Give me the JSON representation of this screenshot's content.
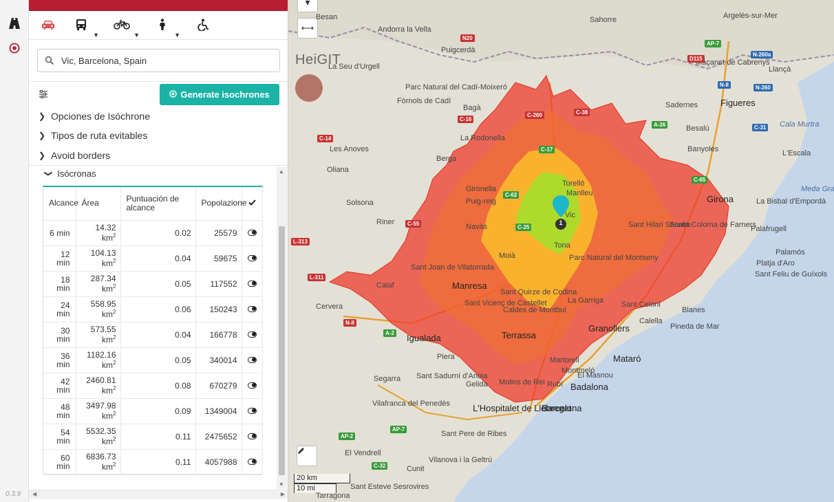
{
  "version": "0.3.9",
  "rail": {
    "items": [
      {
        "icon": "road-icon"
      },
      {
        "icon": "isochrone-target-icon"
      }
    ]
  },
  "profiles": [
    {
      "icon": "car-icon",
      "active": true
    },
    {
      "icon": "bus-icon",
      "dropdown": true
    },
    {
      "icon": "bicycle-icon",
      "dropdown": true
    },
    {
      "icon": "walking-icon",
      "dropdown": true
    },
    {
      "icon": "wheelchair-icon",
      "dropdown": false
    }
  ],
  "search": {
    "value": "Vic, Barcelona, Spain",
    "placeholder": ""
  },
  "generate_button": "Generate isochrones",
  "sections": {
    "options": "Opciones de Isóchrone",
    "avoidables": "Tipos de ruta evitables",
    "borders": "Avoid borders",
    "isochrones": "Isócronas"
  },
  "table": {
    "headers": {
      "range": "Alcance",
      "area": "Área",
      "score": "Puntuación de alcance",
      "population": "Popolazione"
    },
    "area_unit": "km",
    "rows": [
      {
        "range": "6 min",
        "area": "14.32",
        "score": "0.02",
        "population": "25579"
      },
      {
        "range": "12 min",
        "area": "104.13",
        "score": "0.04",
        "population": "59675"
      },
      {
        "range": "18 min",
        "area": "287.34",
        "score": "0.05",
        "population": "117552"
      },
      {
        "range": "24 min",
        "area": "558.95",
        "score": "0.06",
        "population": "150243"
      },
      {
        "range": "30 min",
        "area": "573.55",
        "score": "0.04",
        "population": "166778"
      },
      {
        "range": "36 min",
        "area": "1182.16",
        "score": "0.05",
        "population": "340014"
      },
      {
        "range": "42 min",
        "area": "2460.81",
        "score": "0.08",
        "population": "670279"
      },
      {
        "range": "48 min",
        "area": "3497.98",
        "score": "0.09",
        "population": "1349004"
      },
      {
        "range": "54 min",
        "area": "5532.35",
        "score": "0.11",
        "population": "2475652"
      },
      {
        "range": "60 min",
        "area": "6836.73",
        "score": "0.11",
        "population": "4057988"
      }
    ]
  },
  "map": {
    "brand": "HeiGIT",
    "pin_label": "1",
    "scale": {
      "km": "20 km",
      "mi": "10 mi"
    },
    "colors": {
      "inner": "#9be52a",
      "mid": "#ffd028",
      "outer": "#ef3c2d",
      "water": "#c5d6ea",
      "land": "#e3e1d6"
    },
    "places": [
      {
        "name": "Andorra la Vella"
      },
      {
        "name": "La Seu d'Urgell"
      },
      {
        "name": "Besan"
      },
      {
        "name": "Puigcerdà"
      },
      {
        "name": "Sahorre"
      },
      {
        "name": "Argelès-sur-Mer"
      },
      {
        "name": "Maçanet de Cabrenys"
      },
      {
        "name": "Llançà"
      },
      {
        "name": "Parc Natural del Cadí-Moixeró"
      },
      {
        "name": "Fòrnols de Cadí"
      },
      {
        "name": "Bagà"
      },
      {
        "name": "La Rodonella"
      },
      {
        "name": "Sadernes"
      },
      {
        "name": "Figueres"
      },
      {
        "name": "Besalú"
      },
      {
        "name": "Banyoles"
      },
      {
        "name": "Cala Murtra"
      },
      {
        "name": "L'Escala"
      },
      {
        "name": "Les Anoves"
      },
      {
        "name": "Oliana"
      },
      {
        "name": "Solsona"
      },
      {
        "name": "Riner"
      },
      {
        "name": "Berga"
      },
      {
        "name": "Gironella"
      },
      {
        "name": "Puig-reig"
      },
      {
        "name": "Navàs"
      },
      {
        "name": "Torelló"
      },
      {
        "name": "Manlleu"
      },
      {
        "name": "Vic"
      },
      {
        "name": "Tona"
      },
      {
        "name": "Girona"
      },
      {
        "name": "La Bisbal d'Empordà"
      },
      {
        "name": "Palafrugell"
      },
      {
        "name": "Palamós"
      },
      {
        "name": "Platja d'Aro"
      },
      {
        "name": "Sant Feliu de Guíxols"
      },
      {
        "name": "Sant Hilari Sacalm"
      },
      {
        "name": "Santa Coloma de Farners"
      },
      {
        "name": "Moià"
      },
      {
        "name": "Parc Natural del Montseny"
      },
      {
        "name": "Sant Joan de Vilatorrada"
      },
      {
        "name": "Manresa"
      },
      {
        "name": "Calaf"
      },
      {
        "name": "Cervera"
      },
      {
        "name": "Sant Quirze de Codina"
      },
      {
        "name": "Sant Vicenç de Castellet"
      },
      {
        "name": "Caldes de Montbui"
      },
      {
        "name": "La Garriga"
      },
      {
        "name": "Sant Celoni"
      },
      {
        "name": "Blanes"
      },
      {
        "name": "Calella"
      },
      {
        "name": "Pineda de Mar"
      },
      {
        "name": "Igualada"
      },
      {
        "name": "Terrassa"
      },
      {
        "name": "Granollers"
      },
      {
        "name": "Mataró"
      },
      {
        "name": "Piera"
      },
      {
        "name": "Martorell"
      },
      {
        "name": "Montmeló"
      },
      {
        "name": "Rubí"
      },
      {
        "name": "El Masnou"
      },
      {
        "name": "Badalona"
      },
      {
        "name": "Barcelona"
      },
      {
        "name": "L'Hospitalet de Llobregat"
      },
      {
        "name": "Gelida"
      },
      {
        "name": "Vilafranca del Penedès"
      },
      {
        "name": "Sant Pere de Ribes"
      },
      {
        "name": "El Vendrell"
      },
      {
        "name": "Vilanova i la Geltrú"
      },
      {
        "name": "Cunit"
      },
      {
        "name": "Segarra"
      },
      {
        "name": "Sant Sadurní d'Anoia"
      },
      {
        "name": "Molins de Rei"
      },
      {
        "name": "Meda Gran"
      },
      {
        "name": "Sant Esteve Sesrovires"
      },
      {
        "name": "Tarragona"
      }
    ],
    "roads": [
      {
        "ref": "N20",
        "color": "red"
      },
      {
        "ref": "D115",
        "color": "red"
      },
      {
        "ref": "AP-7",
        "color": "green"
      },
      {
        "ref": "N-260a",
        "color": "blue"
      },
      {
        "ref": "N-II",
        "color": "blue"
      },
      {
        "ref": "N-260",
        "color": "blue"
      },
      {
        "ref": "C-16",
        "color": "red"
      },
      {
        "ref": "C-14",
        "color": "red"
      },
      {
        "ref": "A-26",
        "color": "green"
      },
      {
        "ref": "C-31",
        "color": "blue"
      },
      {
        "ref": "C-55",
        "color": "red"
      },
      {
        "ref": "L-313",
        "color": "red"
      },
      {
        "ref": "L-311",
        "color": "red"
      },
      {
        "ref": "A-2",
        "color": "green"
      },
      {
        "ref": "AP-2",
        "color": "green"
      },
      {
        "ref": "AP-7",
        "color": "green"
      },
      {
        "ref": "C-32",
        "color": "green"
      },
      {
        "ref": "C-65",
        "color": "green"
      },
      {
        "ref": "C-17",
        "color": "green"
      },
      {
        "ref": "C-25",
        "color": "green"
      },
      {
        "ref": "C-62",
        "color": "green"
      },
      {
        "ref": "C-38",
        "color": "red"
      },
      {
        "ref": "C-260",
        "color": "red"
      },
      {
        "ref": "N-II",
        "color": "red"
      }
    ]
  }
}
